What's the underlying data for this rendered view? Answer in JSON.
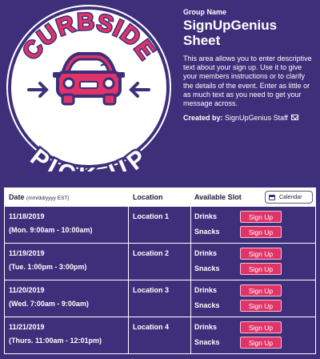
{
  "logo": {
    "top_text": "CURBSIDE",
    "bottom_text": "PICK-UP",
    "colors": {
      "navy": "#3d2f7a",
      "pink": "#e03468",
      "white": "#ffffff"
    }
  },
  "header": {
    "group_label": "Group Name",
    "title_line1": "SignUpGenius",
    "title_line2": "Sheet",
    "description": "This area allows you to enter descriptive text about your sign up. Use it to give your members instructions or to clarify the details of the event. Enter as little or as much text as you need to get your message across.",
    "created_by_label": "Created by:",
    "created_by_name": "SignUpGenius Staff"
  },
  "table": {
    "columns": {
      "date": "Date",
      "date_format": "(mm/dd/yyyy EST)",
      "location": "Location",
      "slot": "Available Slot"
    },
    "calendar_button": "Calendar",
    "signup_label": "Sign Up",
    "rows": [
      {
        "date": "11/18/2019",
        "time": "(Mon. 9:00am - 10:00am)",
        "location": "Location 1",
        "slots": [
          "Drinks",
          "Snacks"
        ]
      },
      {
        "date": "11/19/2019",
        "time": "(Tue. 1:00pm - 3:00pm)",
        "location": "Location 2",
        "slots": [
          "Drinks",
          "Snacks"
        ]
      },
      {
        "date": "11/20/2019",
        "time": "(Wed. 7:00am - 9:00am)",
        "location": "Location 3",
        "slots": [
          "Drinks",
          "Snacks"
        ]
      },
      {
        "date": "11/21/2019",
        "time": "(Thurs. 11:00am - 12:01pm)",
        "location": "Location 4",
        "slots": [
          "Drinks",
          "Snacks"
        ]
      }
    ]
  }
}
